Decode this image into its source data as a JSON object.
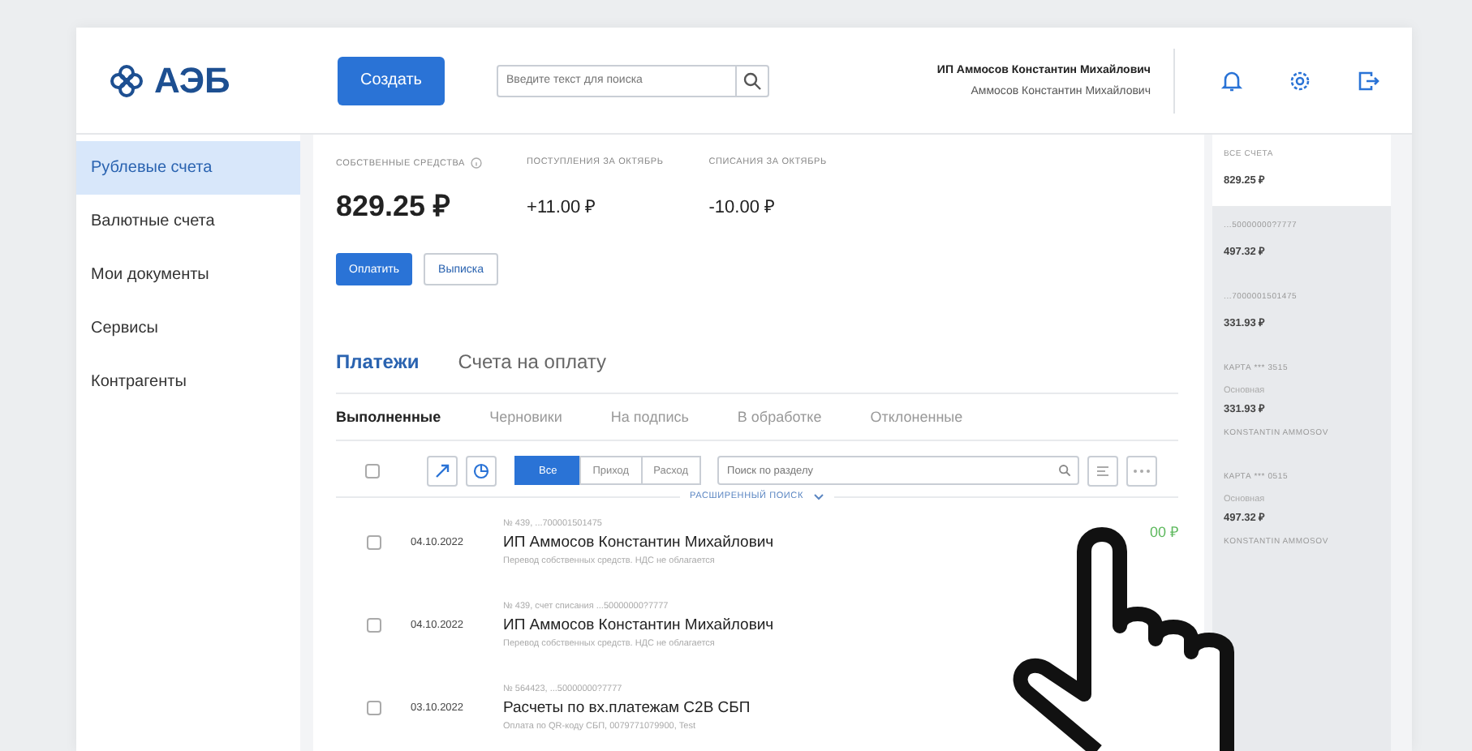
{
  "header": {
    "logo": "АЭБ",
    "create_button": "Создать",
    "search": {
      "placeholder": "Введите текст для поиска"
    },
    "user": {
      "company": "ИП Аммосов Константин Михайлович",
      "name": "Аммосов Константин Михайлович"
    }
  },
  "sidebar": {
    "items": [
      {
        "label": "Рублевые счета",
        "selected": true
      },
      {
        "label": "Валютные счета",
        "selected": false
      },
      {
        "label": "Мои документы",
        "selected": false
      },
      {
        "label": "Сервисы",
        "selected": false
      },
      {
        "label": "Контрагенты",
        "selected": false
      }
    ]
  },
  "summary": {
    "stats": [
      {
        "kind": "main",
        "label": "СОБСТВЕННЫЕ СРЕДСТВА",
        "value": "829.25 ₽"
      },
      {
        "kind": "plain",
        "label": "ПОСТУПЛЕНИЯ ЗА ОКТЯБРЬ",
        "value": "+11.00 ₽"
      },
      {
        "kind": "plain",
        "label": "СПИСАНИЯ ЗА ОКТЯБРЬ",
        "value": "-10.00 ₽"
      }
    ],
    "buttons": [
      {
        "kind": "primary",
        "label": "Оплатить"
      },
      {
        "kind": "secondary",
        "label": "Выписка"
      }
    ]
  },
  "payments": {
    "tabs": [
      {
        "label": "Платежи",
        "selected": true
      },
      {
        "label": "Счета на оплату",
        "selected": false
      }
    ],
    "subtabs": [
      {
        "label": "Выполненные",
        "selected": true
      },
      {
        "label": "Черновики",
        "selected": false
      },
      {
        "label": "На подпись",
        "selected": false
      },
      {
        "label": "В обработке",
        "selected": false
      },
      {
        "label": "Отклоненные",
        "selected": false
      }
    ],
    "toolbar": {
      "select_all_checked": false,
      "filters": [
        {
          "label": "Все",
          "selected": true
        },
        {
          "label": "Приход",
          "selected": false
        },
        {
          "label": "Расход",
          "selected": false
        }
      ],
      "search": {
        "placeholder": "Поиск по разделу"
      },
      "advanced_search": "РАСШИРЕННЫЙ ПОИСК"
    },
    "rows": [
      {
        "checked": false,
        "date": "04.10.2022",
        "number": "№ 439, ...700001501475",
        "title": "ИП Аммосов Константин Михайлович",
        "purpose": "Перевод собственных средств. НДС не облагается",
        "amount": "00 ₽"
      },
      {
        "checked": false,
        "date": "04.10.2022",
        "number": "№ 439, счет списания ...50000000?7777",
        "title": "ИП Аммосов Константин Михайлович",
        "purpose": "Перевод собственных средств. НДС не облагается"
      },
      {
        "checked": false,
        "date": "03.10.2022",
        "number": "№ 564423, ...50000000?7777",
        "title": "Расчеты по вх.платежам C2B СБП",
        "purpose": "Оплата по QR-коду СБП, 0079771079900, Test"
      }
    ]
  },
  "accounts": {
    "items": [
      {
        "kind": "total",
        "label": "ВСЕ СЧЕТА",
        "amount": "829.25 ₽",
        "selected": true
      },
      {
        "kind": "account",
        "label": "...50000000?7777",
        "amount": "497.32 ₽",
        "selected": false
      },
      {
        "kind": "account",
        "label": "...7000001501475",
        "amount": "331.93 ₽",
        "selected": false
      },
      {
        "kind": "card",
        "label": "КАРТА *** 3515",
        "tag": "Основная",
        "amount": "331.93 ₽",
        "holder": "KONSTANTIN AMMOSOV",
        "selected": false
      },
      {
        "kind": "card",
        "label": "КАРТА *** 0515",
        "tag": "Основная",
        "amount": "497.32 ₽",
        "holder": "KONSTANTIN AMMOSOV",
        "selected": false
      }
    ]
  }
}
